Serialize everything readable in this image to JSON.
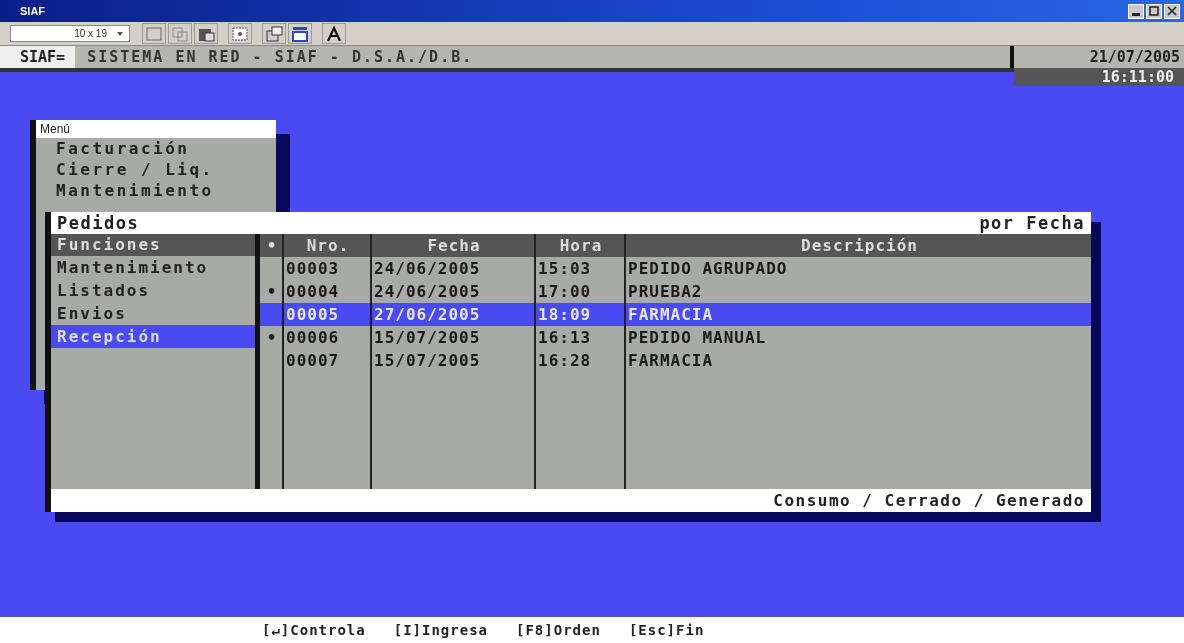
{
  "window": {
    "title": "SIAF"
  },
  "toolbar": {
    "font_size": "10 x 19"
  },
  "header": {
    "system": "SIAF=",
    "title": "SISTEMA EN RED - SIAF - D.S.A./D.B.",
    "date": "21/07/2005",
    "time": "16:11:00"
  },
  "menu": {
    "title": "Menú",
    "items": [
      "Facturación",
      "Cierre / Liq.",
      "Mantenimiento"
    ]
  },
  "dialog": {
    "title": "Pedidos",
    "order": "por Fecha",
    "functions_header": "Funciones",
    "functions": [
      {
        "label": "Mantenimiento",
        "selected": false
      },
      {
        "label": "Listados",
        "selected": false
      },
      {
        "label": "Envios",
        "selected": false
      },
      {
        "label": "Recepción",
        "selected": true
      }
    ],
    "columns": [
      "•",
      "Nro.",
      "Fecha",
      "Hora",
      "Descripción"
    ],
    "rows": [
      {
        "nro": "00003",
        "fecha": "24/06/2005",
        "hora": "15:03",
        "descripcion": "PEDIDO AGRUPADO",
        "selected": false
      },
      {
        "flag": "•",
        "nro": "00004",
        "fecha": "24/06/2005",
        "hora": "17:00",
        "descripcion": "PRUEBA2",
        "selected": false
      },
      {
        "nro": "00005",
        "fecha": "27/06/2005",
        "hora": "18:09",
        "descripcion": "FARMACIA",
        "selected": true
      },
      {
        "flag": "•",
        "nro": "00006",
        "fecha": "15/07/2005",
        "hora": "16:13",
        "descripcion": "PEDIDO MANUAL",
        "selected": false
      },
      {
        "nro": "00007",
        "fecha": "15/07/2005",
        "hora": "16:28",
        "descripcion": "FARMACIA",
        "selected": false
      }
    ],
    "footer": "Consumo / Cerrado / Generado"
  },
  "status_bar": [
    "[↵]Controla",
    "[I]Ingresa",
    "[F8]Orden",
    "[Esc]Fin"
  ]
}
